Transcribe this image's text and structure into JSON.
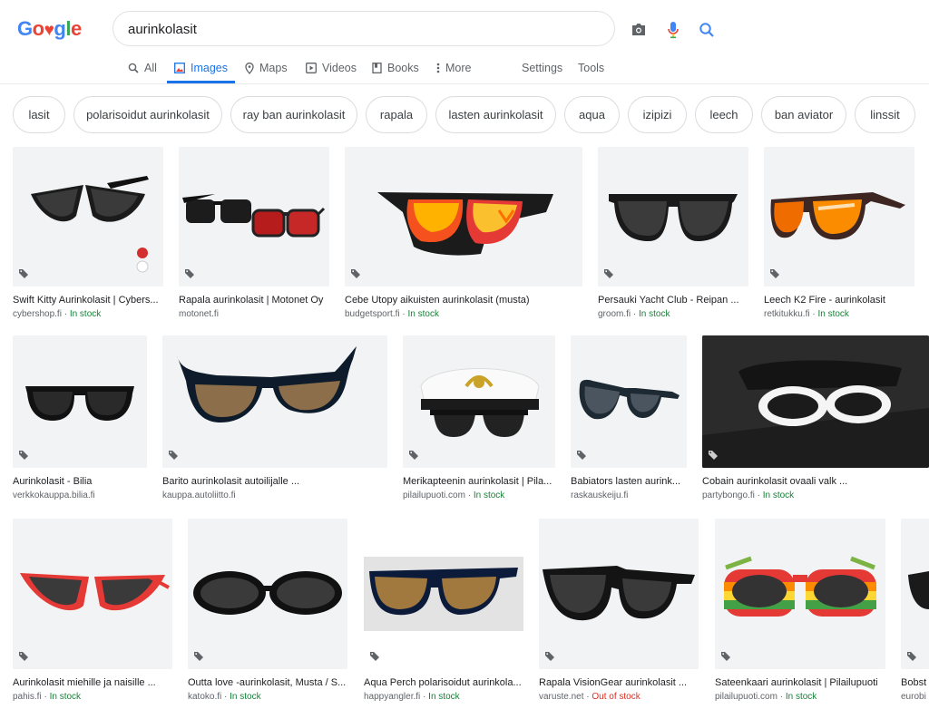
{
  "logo": {
    "letters": [
      "G",
      "o",
      "♥",
      "g",
      "l",
      "e"
    ]
  },
  "search": {
    "query": "aurinkolasit"
  },
  "tabs": [
    {
      "label": "All",
      "icon": "search-icon"
    },
    {
      "label": "Images",
      "icon": "image-icon"
    },
    {
      "label": "Maps",
      "icon": "map-pin-icon"
    },
    {
      "label": "Videos",
      "icon": "video-icon"
    },
    {
      "label": "Books",
      "icon": "book-icon"
    },
    {
      "label": "More",
      "icon": "more-vert-icon"
    },
    {
      "label": "Settings"
    },
    {
      "label": "Tools"
    }
  ],
  "chips": [
    "lasit",
    "polarisoidut aurinkolasit",
    "ray ban aurinkolasit",
    "rapala",
    "lasten aurinkolasit",
    "aqua",
    "izipizi",
    "leech",
    "ban aviator",
    "linssit"
  ],
  "colors": {
    "accent": "#1a73e8",
    "in_stock": "#188038",
    "out_of_stock": "#d93025"
  },
  "results": [
    {
      "title": "Swift Kitty Aurinkolasit | Cybers...",
      "source": "cybershop.fi",
      "stock": "In stock"
    },
    {
      "title": "Rapala aurinkolasit | Motonet Oy",
      "source": "motonet.fi",
      "stock": ""
    },
    {
      "title": "Cebe Utopy aikuisten aurinkolasit (musta)",
      "source": "budgetsport.fi",
      "stock": "In stock"
    },
    {
      "title": "Persauki Yacht Club - Reipan ...",
      "source": "groom.fi",
      "stock": "In stock"
    },
    {
      "title": "Leech K2 Fire - aurinkolasit",
      "source": "retkitukku.fi",
      "stock": "In stock"
    },
    {
      "title": "Aurinkolasit - Bilia",
      "source": "verkkokauppa.bilia.fi",
      "stock": ""
    },
    {
      "title": "Barito aurinkolasit autoilijalle ...",
      "source": "kauppa.autoliitto.fi",
      "stock": ""
    },
    {
      "title": "Merikapteenin aurinkolasit | Pila...",
      "source": "pilailupuoti.com",
      "stock": "In stock"
    },
    {
      "title": "Babiators lasten aurink...",
      "source": "raskauskeiju.fi",
      "stock": ""
    },
    {
      "title": "Cobain aurinkolasit ovaali valk ...",
      "source": "partybongo.fi",
      "stock": "In stock"
    },
    {
      "title": "Aurinkolasit miehille ja naisille ...",
      "source": "pahis.fi",
      "stock": "In stock"
    },
    {
      "title": "Outta love -aurinkolasit, Musta / S...",
      "source": "katoko.fi",
      "stock": "In stock"
    },
    {
      "title": "Aqua Perch polarisoidut aurinkola...",
      "source": "happyangler.fi",
      "stock": "In stock"
    },
    {
      "title": "Rapala VisionGear aurinkolasit ...",
      "source": "varuste.net",
      "stock": "Out of stock"
    },
    {
      "title": "Sateenkaari aurinkolasit | Pilailupuoti",
      "source": "pilailupuoti.com",
      "stock": "In stock"
    },
    {
      "title": "Bobst",
      "source": "eurobi",
      "stock": ""
    }
  ]
}
